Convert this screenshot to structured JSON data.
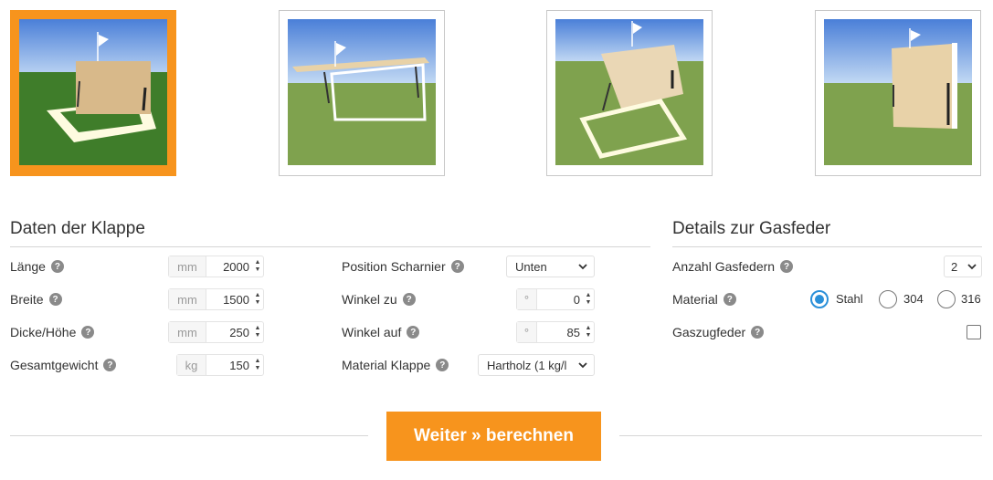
{
  "thumbnails": [
    {
      "name": "hinge-bottom",
      "selected": true
    },
    {
      "name": "hinge-top",
      "selected": false
    },
    {
      "name": "hinge-front",
      "selected": false
    },
    {
      "name": "hinge-side",
      "selected": false
    }
  ],
  "flap_section": {
    "title": "Daten der Klappe",
    "laenge": {
      "label": "Länge",
      "unit": "mm",
      "value": "2000"
    },
    "breite": {
      "label": "Breite",
      "unit": "mm",
      "value": "1500"
    },
    "dicke": {
      "label": "Dicke/Höhe",
      "unit": "mm",
      "value": "250"
    },
    "gewicht": {
      "label": "Gesamtgewicht",
      "unit": "kg",
      "value": "150"
    },
    "scharnier": {
      "label": "Position Scharnier",
      "value": "Unten"
    },
    "winkel_zu": {
      "label": "Winkel zu",
      "unit": "°",
      "value": "0"
    },
    "winkel_auf": {
      "label": "Winkel auf",
      "unit": "°",
      "value": "85"
    },
    "material_klappe": {
      "label": "Material Klappe",
      "value": "Hartholz (1 kg/l"
    }
  },
  "gas_section": {
    "title": "Details zur Gasfeder",
    "anzahl": {
      "label": "Anzahl Gasfedern",
      "value": "2"
    },
    "material": {
      "label": "Material",
      "options": [
        "Stahl",
        "304",
        "316"
      ],
      "selected": "Stahl"
    },
    "zugfeder": {
      "label": "Gaszugfeder",
      "checked": false
    }
  },
  "help_glyph": "?",
  "spin_up": "▲",
  "spin_down": "▼",
  "submit_label": "Weiter » berechnen",
  "colors": {
    "accent": "#f7941d",
    "radio": "#2b90d9"
  }
}
